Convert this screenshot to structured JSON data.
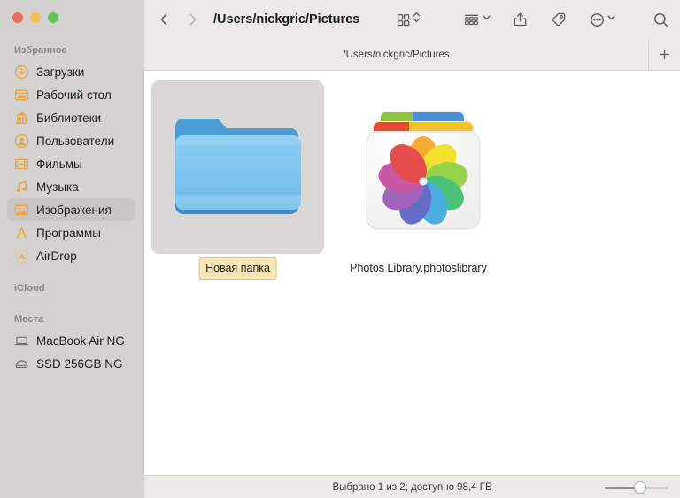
{
  "window": {
    "traffic_lights": [
      {
        "name": "close",
        "color": "#ed6a5e"
      },
      {
        "name": "minimize",
        "color": "#f4bd4f"
      },
      {
        "name": "maximize",
        "color": "#61c454"
      }
    ]
  },
  "toolbar": {
    "back_icon": "chevron-left-icon",
    "forward_icon": "chevron-right-icon",
    "path_title": "/Users/nickgric/Pictures",
    "view_icon": "grid-view-icon",
    "view_stepper_icon": "up-down-chevron-icon",
    "group_icon": "group-by-icon",
    "group_chevron_icon": "chevron-down-icon",
    "share_icon": "share-icon",
    "tag_icon": "tag-icon",
    "more_icon": "ellipsis-circle-icon",
    "more_chevron_icon": "chevron-down-icon",
    "search_icon": "search-icon"
  },
  "tabbar": {
    "active_tab_label": "/Users/nickgric/Pictures",
    "add_tab_label": "+"
  },
  "sidebar": {
    "sections": [
      {
        "header": "Избранное",
        "items": [
          {
            "label": "Загрузки",
            "icon": "download-circle-icon",
            "selected": false
          },
          {
            "label": "Рабочий стол",
            "icon": "desktop-icon",
            "selected": false
          },
          {
            "label": "Библиотеки",
            "icon": "library-bank-icon",
            "selected": false
          },
          {
            "label": "Пользователи",
            "icon": "user-circle-icon",
            "selected": false
          },
          {
            "label": "Фильмы",
            "icon": "film-icon",
            "selected": false
          },
          {
            "label": "Музыка",
            "icon": "music-note-icon",
            "selected": false
          },
          {
            "label": "Изображения",
            "icon": "photo-icon",
            "selected": true
          },
          {
            "label": "Программы",
            "icon": "applications-icon",
            "selected": false
          },
          {
            "label": "AirDrop",
            "icon": "airdrop-icon",
            "selected": false
          }
        ]
      },
      {
        "header": "iCloud",
        "items": []
      },
      {
        "header": "Места",
        "items": [
          {
            "label": "MacBook Air NG",
            "icon": "laptop-icon",
            "selected": false
          },
          {
            "label": "SSD 256GB NG",
            "icon": "disk-icon",
            "selected": false
          }
        ]
      }
    ]
  },
  "content": {
    "items": [
      {
        "name": "Новая папка",
        "icon": "blue-folder-icon",
        "selected": true,
        "renaming": true
      },
      {
        "name": "Photos Library.photoslibrary",
        "icon": "photos-library-icon",
        "selected": false,
        "renaming": false
      }
    ]
  },
  "statusbar": {
    "text": "Выбрано 1 из 2; доступно 98,4 ГБ",
    "zoom_value": 57
  },
  "colors": {
    "sidebar_bg": "#d4d2cf",
    "toolbar_bg": "#eceae7",
    "content_bg": "#ffffff",
    "accent_icon": "#e8a33d",
    "selection": "#c7c6c3",
    "rename_field": "#f6e7b4"
  }
}
